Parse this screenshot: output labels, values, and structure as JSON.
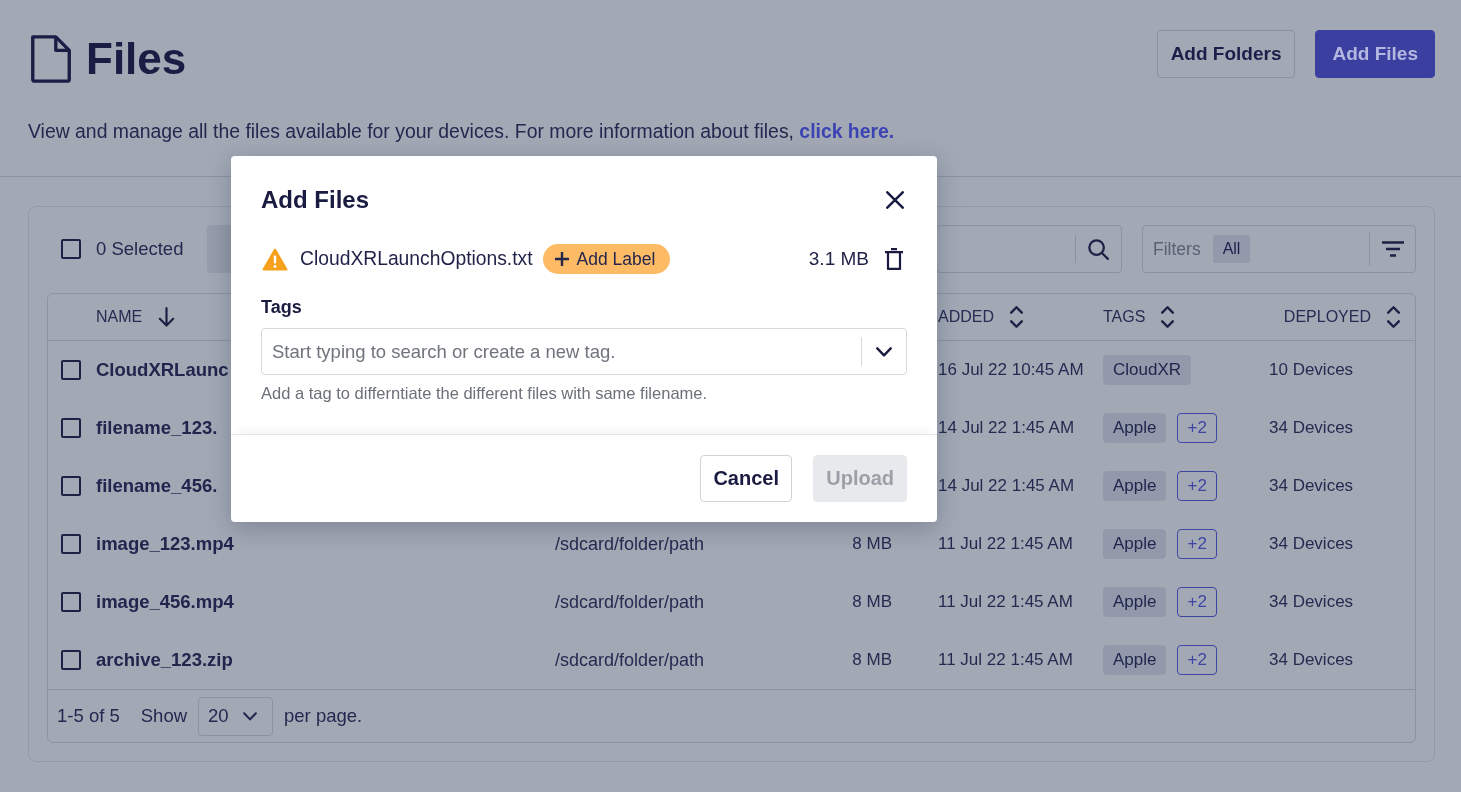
{
  "header": {
    "title": "Files",
    "description": "View and manage all the files available for your devices. For more information about files,",
    "link": "click here.",
    "buttons": [
      {
        "label": "Add Folders",
        "kind": "secondary"
      },
      {
        "label": "Add Files",
        "kind": "primary"
      }
    ]
  },
  "toolbar": {
    "select_all_checked": false,
    "selected_count": "0 Selected",
    "filters": {
      "label": "Filters",
      "value": "All"
    }
  },
  "table": {
    "columns": [
      {
        "label": "NAME",
        "sorted": true
      },
      {
        "label": "ADDED",
        "sorted": false
      },
      {
        "label": "TAGS",
        "sorted": false
      },
      {
        "label": "DEPLOYED",
        "sorted": false
      }
    ],
    "rows": [
      {
        "checked": false,
        "name": "CloudXRLaunc",
        "added": "16 Jul 22 10:45 AM",
        "tags": [
          {
            "label": "CloudXR",
            "kind": "tag"
          }
        ],
        "deployed": "10 Devices"
      },
      {
        "checked": false,
        "name": "filename_123.",
        "added": "14 Jul 22 1:45 AM",
        "tags": [
          {
            "label": "Apple",
            "kind": "tag"
          },
          {
            "label": "+2",
            "kind": "more"
          }
        ],
        "deployed": "34 Devices"
      },
      {
        "checked": false,
        "name": "filename_456.",
        "added": "14 Jul 22 1:45 AM",
        "tags": [
          {
            "label": "Apple",
            "kind": "tag"
          },
          {
            "label": "+2",
            "kind": "more"
          }
        ],
        "deployed": "34 Devices"
      },
      {
        "checked": false,
        "name": "image_123.mp4",
        "path": "/sdcard/folder/path",
        "size": "8 MB",
        "added": "11 Jul 22 1:45 AM",
        "tags": [
          {
            "label": "Apple",
            "kind": "tag"
          },
          {
            "label": "+2",
            "kind": "more"
          }
        ],
        "deployed": "34 Devices"
      },
      {
        "checked": false,
        "name": "image_456.mp4",
        "path": "/sdcard/folder/path",
        "size": "8 MB",
        "added": "11 Jul 22 1:45 AM",
        "tags": [
          {
            "label": "Apple",
            "kind": "tag"
          },
          {
            "label": "+2",
            "kind": "more"
          }
        ],
        "deployed": "34 Devices"
      },
      {
        "checked": false,
        "name": "archive_123.zip",
        "path": "/sdcard/folder/path",
        "size": "8 MB",
        "added": "11 Jul 22 1:45 AM",
        "tags": [
          {
            "label": "Apple",
            "kind": "tag"
          },
          {
            "label": "+2",
            "kind": "more"
          }
        ],
        "deployed": "34 Devices"
      }
    ]
  },
  "pagination": {
    "range": "1-5 of 5",
    "show_label": "Show",
    "per_page": "20",
    "suffix": "per page."
  },
  "modal": {
    "title": "Add Files",
    "file": {
      "name": "CloudXRLaunchOptions.txt",
      "warning": true,
      "add_label": "Add Label",
      "size": "3.1 MB"
    },
    "tags": {
      "label": "Tags",
      "placeholder": "Start typing to search or create a new tag.",
      "helper": "Add a tag to differntiate the different files with same filename."
    },
    "buttons": [
      {
        "label": "Cancel",
        "kind": "secondary",
        "disabled": false
      },
      {
        "label": "Upload",
        "kind": "primary",
        "disabled": true
      }
    ]
  }
}
